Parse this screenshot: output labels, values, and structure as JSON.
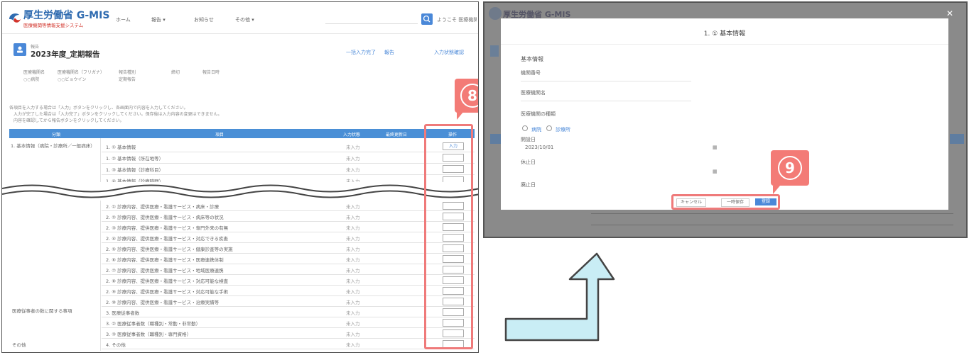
{
  "left": {
    "logo": {
      "title": "厚生労働省 G-MIS",
      "subtitle": "医療機関等情報支援システム"
    },
    "nav": [
      "ホーム",
      "報告",
      "お知らせ",
      "その他"
    ],
    "header_right": "ようこそ 医療機関",
    "report": {
      "small_label": "報告",
      "title": "2023年度_定期報告"
    },
    "actions": [
      "一括入力完了",
      "報告",
      "入力状態確認"
    ],
    "info_cols": [
      {
        "label": "医療機関名",
        "value": "○○病院"
      },
      {
        "label": "医療機関名（フリガナ）",
        "value": "○○ビョウイン"
      },
      {
        "label": "報告種別",
        "value": "定期報告"
      },
      {
        "label": "締切",
        "value": ""
      },
      {
        "label": "報告日時",
        "value": ""
      }
    ],
    "instructions": [
      "各項目を入力する場合は「入力」ボタンをクリックし、各画面内で内容を入力してください。",
      "入力が完了した場合は「入力完了」ボタンをクリックしてください。保存後は入力内容の変更はできません。",
      "内容を確認してから報告ボタンをクリックしてください。"
    ],
    "table_headers": [
      "分類",
      "項目",
      "入力状態",
      "最終更新日",
      "操作"
    ],
    "category_1": "1. 基本情報（病院・診療所／一般病床）",
    "category_2": "医療従事者の数に関する事項",
    "category_3": "その他",
    "rows_top": [
      {
        "item": "1. ① 基本情報",
        "status": "未入力",
        "op": "入力"
      },
      {
        "item": "1. ② 基本情報（所在地等）",
        "status": "未入力",
        "op": ""
      },
      {
        "item": "1. ③ 基本情報（診療科目）",
        "status": "未入力",
        "op": ""
      },
      {
        "item": "1. ④ 基本情報（診療時間）",
        "status": "未入力",
        "op": ""
      }
    ],
    "rows_bottom": [
      {
        "item": "2. ① 診療内容、提供医療・看護サービス・病床・診療",
        "status": "未入力",
        "op": ""
      },
      {
        "item": "2. ② 診療内容、提供医療・看護サービス・病床等の状況",
        "status": "未入力",
        "op": ""
      },
      {
        "item": "2. ③ 診療内容、提供医療・看護サービス・専門外来の有無",
        "status": "未入力",
        "op": ""
      },
      {
        "item": "2. ④ 診療内容、提供医療・看護サービス・対応できる疾患",
        "status": "未入力",
        "op": ""
      },
      {
        "item": "2. ⑤ 診療内容、提供医療・看護サービス・健康診査等の実施",
        "status": "未入力",
        "op": ""
      },
      {
        "item": "2. ⑥ 診療内容、提供医療・看護サービス・医療連携体制",
        "status": "未入力",
        "op": ""
      },
      {
        "item": "2. ⑦ 診療内容、提供医療・看護サービス・地域医療連携",
        "status": "未入力",
        "op": ""
      },
      {
        "item": "2. ⑧ 診療内容、提供医療・看護サービス・対応可能な検査",
        "status": "未入力",
        "op": ""
      },
      {
        "item": "2. ⑨ 診療内容、提供医療・看護サービス・対応可能な手術",
        "status": "未入力",
        "op": ""
      },
      {
        "item": "2. ⑩ 診療内容、提供医療・看護サービス・治療実績等",
        "status": "未入力",
        "op": ""
      },
      {
        "item": "3. 医療従事者数",
        "status": "未入力",
        "op": ""
      },
      {
        "item": "3. ② 医療従事者数（職種別・常勤・非常勤）",
        "status": "未入力",
        "op": ""
      },
      {
        "item": "3. ③ 医療従事者数（職種別・専門資格）",
        "status": "未入力",
        "op": ""
      },
      {
        "item": "4. その他",
        "status": "未入力",
        "op": ""
      }
    ]
  },
  "right": {
    "modal_title": "1. ① 基本情報",
    "section": "基本情報",
    "fields": [
      {
        "label": "機関番号",
        "value": ""
      },
      {
        "label": "医療機関名",
        "value": ""
      },
      {
        "label": "医療機関の種類",
        "value": ""
      },
      {
        "label": "開設日",
        "value": "2023/10/01"
      },
      {
        "label": "休止日",
        "value": ""
      },
      {
        "label": "廃止日",
        "value": ""
      }
    ],
    "radio_options": [
      "病院",
      "診療所"
    ],
    "buttons": [
      "キャンセル",
      "一時保存",
      "登録"
    ]
  },
  "annotations": {
    "step_8": "8",
    "step_9": "9"
  },
  "colors": {
    "highlight": "#ef7a7a",
    "header_blue": "#4a8fd6",
    "arrow_fill": "#c9edf5",
    "arrow_stroke": "#444444"
  }
}
